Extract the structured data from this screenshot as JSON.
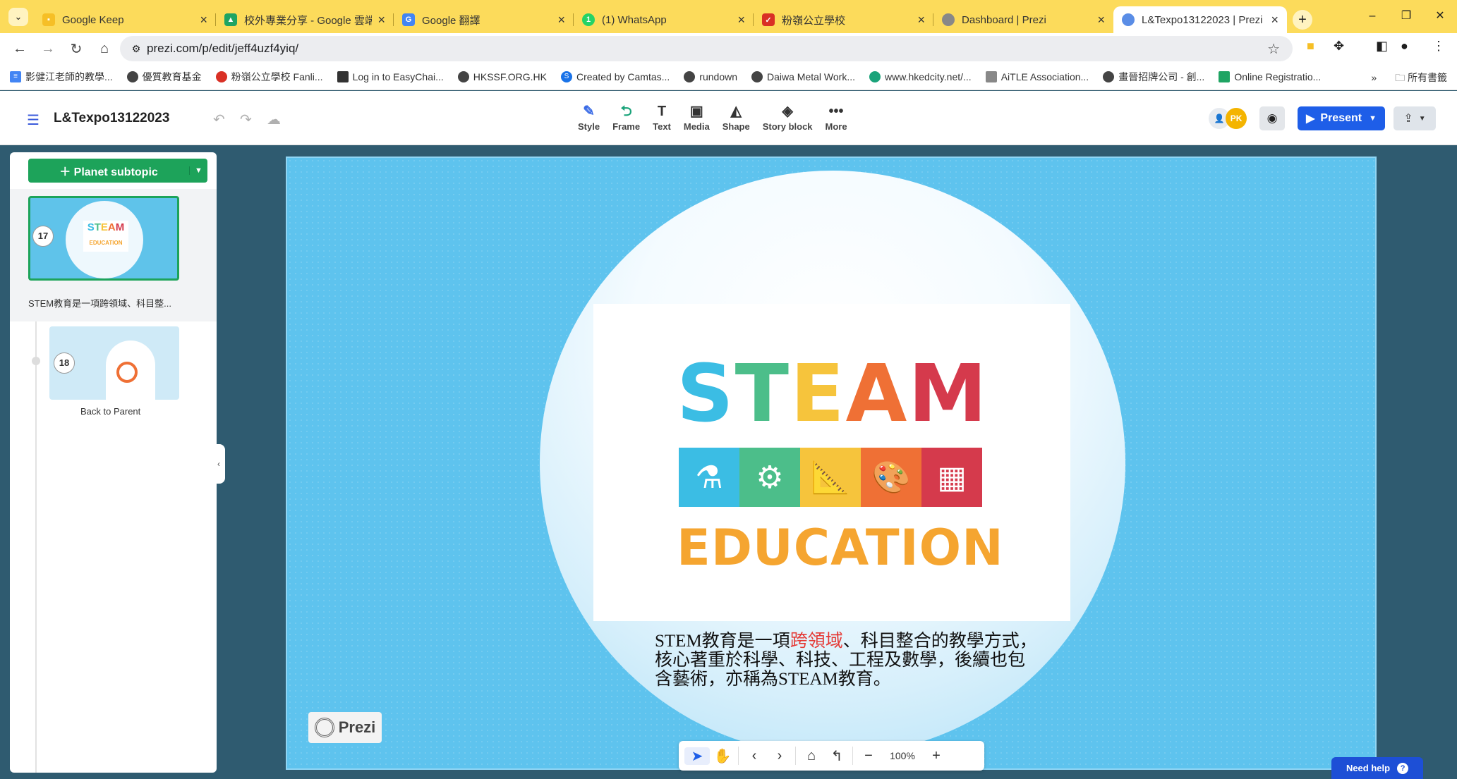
{
  "browser": {
    "tabs": [
      {
        "title": "Google Keep",
        "color": "#f6bf26",
        "icon": "keep-icon"
      },
      {
        "title": "校外專業分享 - Google 雲端硬",
        "color": "#1fa463",
        "icon": "drive-icon"
      },
      {
        "title": "Google 翻譯",
        "color": "#4285f4",
        "icon": "translate-icon"
      },
      {
        "title": "(1) WhatsApp",
        "color": "#25d366",
        "icon": "whatsapp-icon"
      },
      {
        "title": "粉嶺公立學校",
        "color": "#d93025",
        "icon": "school-icon"
      },
      {
        "title": "Dashboard | Prezi",
        "color": "#888888",
        "icon": "prezi-icon"
      },
      {
        "title": "L&Texpo13122023 | Prezi",
        "color": "#5a8de6",
        "icon": "prezi-icon"
      }
    ],
    "url": "prezi.com/p/edit/jeff4uzf4yiq/",
    "bookmarks": [
      "影健江老師的教學...",
      "優質教育基金",
      "粉嶺公立學校 Fanli...",
      "Log in to EasyChai...",
      "HKSSF.ORG.HK",
      "Created by Camtas...",
      "rundown",
      "Daiwa Metal Work...",
      "www.hkedcity.net/...",
      "AiTLE Association...",
      "畫晉招牌公司 - 創...",
      "Online Registratio..."
    ],
    "bookmarks_folder": "所有書籤"
  },
  "editor": {
    "title": "L&Texpo13122023",
    "tools": [
      {
        "label": "Style",
        "icon": "brush-icon"
      },
      {
        "label": "Frame",
        "icon": "frame-icon"
      },
      {
        "label": "Text",
        "icon": "text-icon"
      },
      {
        "label": "Media",
        "icon": "media-icon"
      },
      {
        "label": "Shape",
        "icon": "shape-icon"
      },
      {
        "label": "Story block",
        "icon": "layers-icon"
      },
      {
        "label": "More",
        "icon": "more-icon"
      }
    ],
    "avatar_initials": "PK",
    "present_label": "Present"
  },
  "sidebar": {
    "add_button": "Planet subtopic",
    "items": [
      {
        "number": "17",
        "label": "STEM教育是一項跨領域、科目整..."
      },
      {
        "number": "18",
        "label": "Back to Parent"
      }
    ]
  },
  "slide": {
    "letters": [
      "S",
      "T",
      "E",
      "A",
      "M"
    ],
    "letter_colors": [
      "#3bbde4",
      "#4cbe8a",
      "#f6c43c",
      "#ef7035",
      "#d53a4c"
    ],
    "icon_tiles": [
      {
        "icon": "flask-icon",
        "color": "#3bbde4"
      },
      {
        "icon": "gear-bulb-icon",
        "color": "#4cbe8a"
      },
      {
        "icon": "ruler-icon",
        "color": "#f6c43c"
      },
      {
        "icon": "palette-icon",
        "color": "#ef7035"
      },
      {
        "icon": "calculator-icon",
        "color": "#d53a4c"
      }
    ],
    "subtitle": "EDUCATION",
    "caption_before": "STEM教育是一項",
    "caption_highlight": "跨領域",
    "caption_after": "、科目整合的教學方式，核心著重於科學、科技、工程及數學，後續也包含藝術，亦稱為STEAM教育。",
    "logo_text": "Prezi"
  },
  "zoom": {
    "level": "100%"
  },
  "help_label": "Need help"
}
